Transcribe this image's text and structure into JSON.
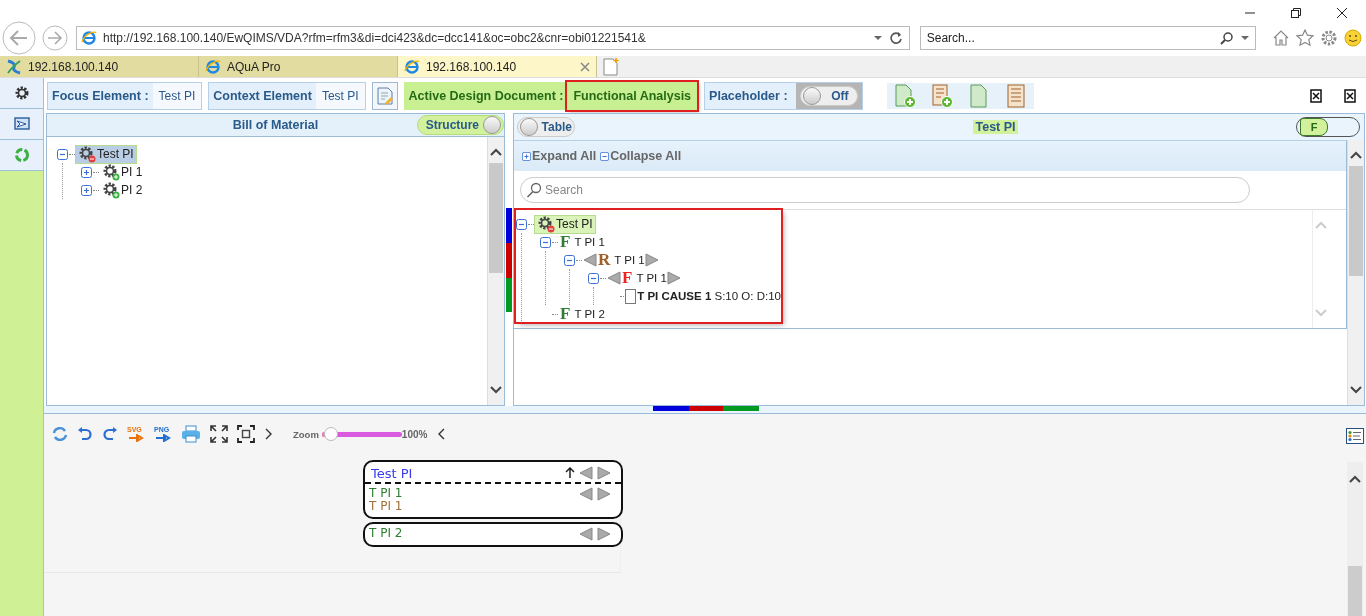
{
  "browser": {
    "address": "http://192.168.100.140/EwQIMS/VDA?rfm=rfm3&di=dci423&dc=dcc141&oc=obc2&cnr=obi01221541&",
    "search_placeholder": "Search...",
    "tabs": [
      {
        "label": "192.168.100.140",
        "kind": "site",
        "selected": false
      },
      {
        "label": "AQuA Pro",
        "kind": "ie",
        "selected": false
      },
      {
        "label": "192.168.100.140",
        "kind": "ie",
        "selected": true
      }
    ]
  },
  "toolbar": {
    "focus": {
      "label": "Focus Element :",
      "value": "Test PI"
    },
    "context": {
      "label": "Context Element",
      "value": "Test PI"
    },
    "active_document": {
      "label": "Active Design Document :",
      "value": "Functional Analysis",
      "highlighted": true
    },
    "placeholder": {
      "label": "Placeholder :",
      "toggle": {
        "label": "Off",
        "on": false
      }
    }
  },
  "bom_panel": {
    "title": "Bill of Material",
    "toggle": {
      "label": "Structure",
      "on": true
    },
    "tree": [
      {
        "label": "Test PI",
        "selected": true,
        "expanded": true,
        "children": [
          {
            "label": "PI 1",
            "selected": false,
            "expanded": false
          },
          {
            "label": "PI 2",
            "selected": false,
            "expanded": false
          }
        ]
      }
    ]
  },
  "analysis_panel": {
    "toggle": {
      "label": "Table",
      "on": false
    },
    "title": "Test PI",
    "filter": {
      "label": "F",
      "on": true
    },
    "expand_all": "Expand All",
    "collapse_all": "Collapse All",
    "search_placeholder": "Search",
    "tree_highlighted": true,
    "tree": [
      {
        "kind": "element",
        "label": "Test PI",
        "selected": true,
        "expanded": true,
        "children": [
          {
            "kind": "function",
            "letter": "F",
            "color": "#2e7d32",
            "label": "T PI 1",
            "arrows": false,
            "expanded": true,
            "children": [
              {
                "kind": "function",
                "letter": "R",
                "color": "#a0602a",
                "label": "T PI 1",
                "arrows": true,
                "expanded": true,
                "children": [
                  {
                    "kind": "function",
                    "letter": "F",
                    "color": "#ee2222",
                    "label": "T PI 1",
                    "arrows": true,
                    "expanded": true,
                    "children": [
                      {
                        "kind": "cause",
                        "label": "**T PI CAUSE 1** S:10 O: D:10",
                        "checked": false
                      }
                    ]
                  }
                ]
              }
            ]
          },
          {
            "kind": "function",
            "letter": "F",
            "color": "#2e7d32",
            "label": "T PI 2",
            "arrows": false
          }
        ]
      }
    ]
  },
  "diagram": {
    "export_svg": "SVG",
    "export_png": "PNG",
    "zoom_label": "Zoom",
    "zoom": {
      "level": 0.12,
      "reading": "100%"
    },
    "blocks": [
      {
        "title": "Test PI",
        "items": [
          {
            "label": "T PI 1",
            "color": "#2e7d32"
          },
          {
            "label": "T PI 1",
            "color": "#a0703a"
          }
        ]
      },
      {
        "items": [
          {
            "label": "T PI 2",
            "color": "#2e7d32"
          }
        ]
      }
    ]
  }
}
